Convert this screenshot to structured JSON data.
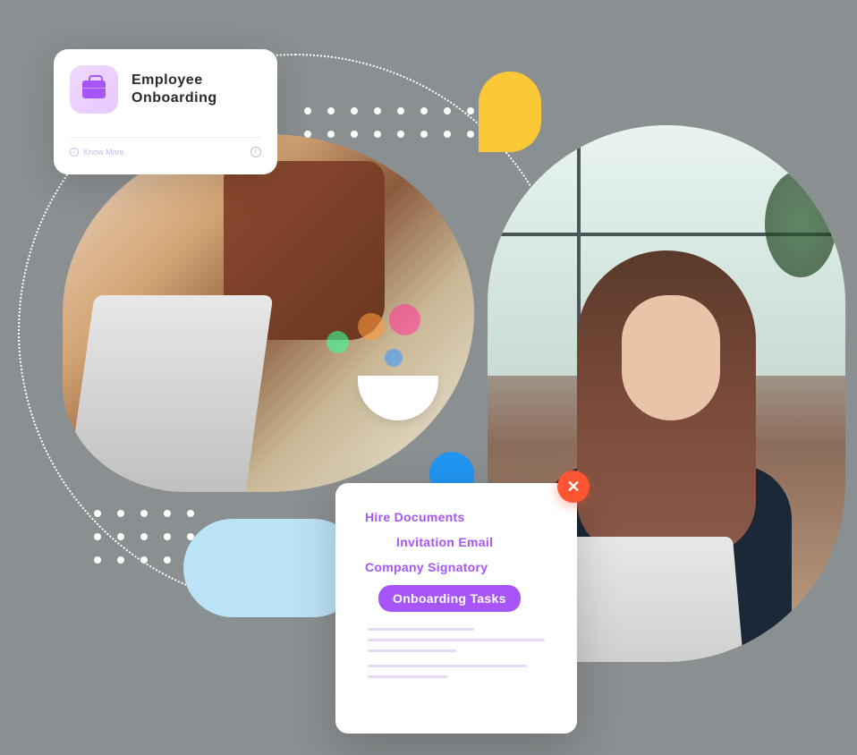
{
  "topCard": {
    "title": "Employee\nOnboarding",
    "footerLink": "Know More",
    "iconName": "briefcase-icon"
  },
  "bottomCard": {
    "items": [
      "Hire Documents",
      "Invitation Email",
      "Company Signatory"
    ],
    "pill": "Onboarding Tasks",
    "closeLabel": "✕"
  },
  "colors": {
    "accent": "#a855f7",
    "close": "#ff5533",
    "yellow": "#f9c834",
    "blue": "#2196f3",
    "lightBlue": "#bce3f5"
  }
}
